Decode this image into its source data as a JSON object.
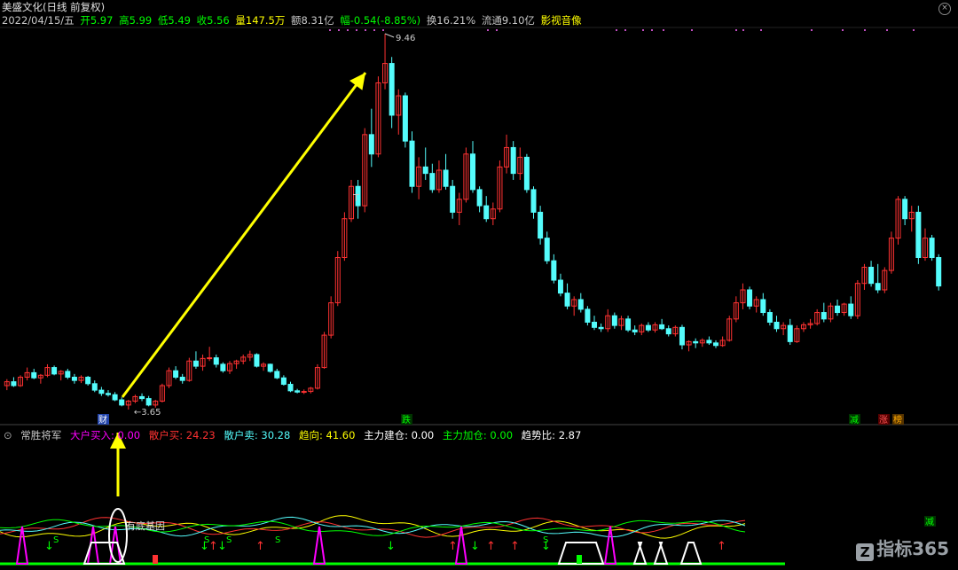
{
  "header": {
    "title": "美盛文化(日线 前复权)",
    "date": "2022/04/15/五",
    "open": "开5.97",
    "high": "高5.99",
    "low": "低5.49",
    "close": "收5.56",
    "volume": "量147.5万",
    "amount": "额8.31亿",
    "change": "幅-0.54(-8.85%)",
    "turnover": "换16.21%",
    "float": "流通9.10亿",
    "sector": "影视音像"
  },
  "indicator": {
    "name": "常胜将军",
    "big_buy": "大户买入: 0.00",
    "retail_sell": "散户买: 24.23",
    "retail_out": "散户卖: 30.28",
    "trend": "趋向: 41.60",
    "main_build": "主力建仓: 0.00",
    "main_add": "主力加仓: 0.00",
    "trend_ratio": "趋势比: 2.87",
    "note": "有底基因"
  },
  "watermark": "指标365",
  "colors": {
    "up": "#ff3232",
    "down": "#54fcfc",
    "arrow": "#ffff00",
    "magenta": "#ff00ff",
    "green": "#00ff00"
  },
  "chart_data": {
    "type": "candlestick",
    "y_labels": {
      "high_mark": "9.46",
      "low_mark": "3.65"
    },
    "tags": [
      "财",
      "跌",
      "减",
      "涨",
      "榜"
    ],
    "candles": [
      [
        4.02,
        4.12,
        3.95,
        4.08
      ],
      [
        4.08,
        4.15,
        4.0,
        4.02
      ],
      [
        4.02,
        4.18,
        4.0,
        4.15
      ],
      [
        4.15,
        4.3,
        4.1,
        4.22
      ],
      [
        4.22,
        4.28,
        4.12,
        4.14
      ],
      [
        4.14,
        4.2,
        4.05,
        4.18
      ],
      [
        4.18,
        4.35,
        4.15,
        4.3
      ],
      [
        4.3,
        4.33,
        4.18,
        4.2
      ],
      [
        4.2,
        4.26,
        4.1,
        4.24
      ],
      [
        4.24,
        4.28,
        4.12,
        4.15
      ],
      [
        4.15,
        4.2,
        4.05,
        4.1
      ],
      [
        4.1,
        4.18,
        4.06,
        4.15
      ],
      [
        4.15,
        4.17,
        4.02,
        4.05
      ],
      [
        4.05,
        4.1,
        3.92,
        3.95
      ],
      [
        3.95,
        4.0,
        3.86,
        3.9
      ],
      [
        3.9,
        3.95,
        3.85,
        3.88
      ],
      [
        3.88,
        3.92,
        3.78,
        3.8
      ],
      [
        3.8,
        3.84,
        3.7,
        3.72
      ],
      [
        3.72,
        3.8,
        3.65,
        3.78
      ],
      [
        3.78,
        3.88,
        3.75,
        3.85
      ],
      [
        3.85,
        3.9,
        3.78,
        3.82
      ],
      [
        3.82,
        3.86,
        3.7,
        3.72
      ],
      [
        3.72,
        3.8,
        3.68,
        3.78
      ],
      [
        3.78,
        4.05,
        3.76,
        4.02
      ],
      [
        4.02,
        4.3,
        3.98,
        4.25
      ],
      [
        4.25,
        4.32,
        4.12,
        4.15
      ],
      [
        4.15,
        4.2,
        4.05,
        4.1
      ],
      [
        4.1,
        4.45,
        4.08,
        4.4
      ],
      [
        4.4,
        4.55,
        4.28,
        4.32
      ],
      [
        4.32,
        4.5,
        4.25,
        4.44
      ],
      [
        4.44,
        4.62,
        4.4,
        4.45
      ],
      [
        4.45,
        4.5,
        4.3,
        4.35
      ],
      [
        4.35,
        4.38,
        4.22,
        4.25
      ],
      [
        4.25,
        4.4,
        4.2,
        4.36
      ],
      [
        4.36,
        4.42,
        4.28,
        4.4
      ],
      [
        4.4,
        4.5,
        4.35,
        4.46
      ],
      [
        4.46,
        4.56,
        4.4,
        4.5
      ],
      [
        4.5,
        4.52,
        4.3,
        4.32
      ],
      [
        4.32,
        4.38,
        4.25,
        4.35
      ],
      [
        4.35,
        4.36,
        4.22,
        4.24
      ],
      [
        4.24,
        4.28,
        4.12,
        4.14
      ],
      [
        4.14,
        4.18,
        4.02,
        4.04
      ],
      [
        4.04,
        4.08,
        3.92,
        3.94
      ],
      [
        3.94,
        3.97,
        3.9,
        3.92
      ],
      [
        3.92,
        3.96,
        3.89,
        3.93
      ],
      [
        3.93,
        4.0,
        3.9,
        3.98
      ],
      [
        3.98,
        4.35,
        3.96,
        4.3
      ],
      [
        4.3,
        4.85,
        4.28,
        4.8
      ],
      [
        4.8,
        5.4,
        4.75,
        5.3
      ],
      [
        5.3,
        6.1,
        5.25,
        6.0
      ],
      [
        6.0,
        6.7,
        5.95,
        6.6
      ],
      [
        6.6,
        7.2,
        6.55,
        7.1
      ],
      [
        7.1,
        7.2,
        6.6,
        6.8
      ],
      [
        6.8,
        8.0,
        6.7,
        7.9
      ],
      [
        7.9,
        8.3,
        7.4,
        7.6
      ],
      [
        7.6,
        8.8,
        7.55,
        8.7
      ],
      [
        8.7,
        9.46,
        8.6,
        9.0
      ],
      [
        9.0,
        9.1,
        8.0,
        8.2
      ],
      [
        8.2,
        8.6,
        7.9,
        8.5
      ],
      [
        8.5,
        8.55,
        7.7,
        7.8
      ],
      [
        7.8,
        7.95,
        7.0,
        7.1
      ],
      [
        7.1,
        7.55,
        6.9,
        7.4
      ],
      [
        7.4,
        7.7,
        7.2,
        7.3
      ],
      [
        7.3,
        7.45,
        7.0,
        7.05
      ],
      [
        7.05,
        7.5,
        7.0,
        7.35
      ],
      [
        7.35,
        7.6,
        7.05,
        7.1
      ],
      [
        7.1,
        7.2,
        6.6,
        6.7
      ],
      [
        6.7,
        7.0,
        6.5,
        6.9
      ],
      [
        6.9,
        7.7,
        6.85,
        7.6
      ],
      [
        7.6,
        7.8,
        7.0,
        7.05
      ],
      [
        7.05,
        7.1,
        6.7,
        6.8
      ],
      [
        6.8,
        6.95,
        6.55,
        6.6
      ],
      [
        6.6,
        6.85,
        6.5,
        6.75
      ],
      [
        6.75,
        7.5,
        6.7,
        7.4
      ],
      [
        7.4,
        7.9,
        7.3,
        7.7
      ],
      [
        7.7,
        7.8,
        7.2,
        7.3
      ],
      [
        7.3,
        7.7,
        7.2,
        7.55
      ],
      [
        7.55,
        7.6,
        7.0,
        7.05
      ],
      [
        7.05,
        7.1,
        6.6,
        6.7
      ],
      [
        6.7,
        6.8,
        6.2,
        6.3
      ],
      [
        6.3,
        6.4,
        5.9,
        5.95
      ],
      [
        5.95,
        6.05,
        5.6,
        5.65
      ],
      [
        5.65,
        5.75,
        5.4,
        5.45
      ],
      [
        5.45,
        5.6,
        5.2,
        5.25
      ],
      [
        5.25,
        5.4,
        5.1,
        5.35
      ],
      [
        5.35,
        5.45,
        5.15,
        5.2
      ],
      [
        5.2,
        5.25,
        4.95,
        5.0
      ],
      [
        5.0,
        5.1,
        4.88,
        4.92
      ],
      [
        4.92,
        4.98,
        4.85,
        4.9
      ],
      [
        4.9,
        5.2,
        4.85,
        5.1
      ],
      [
        5.1,
        5.15,
        4.9,
        4.95
      ],
      [
        4.95,
        5.1,
        4.88,
        5.05
      ],
      [
        5.05,
        5.1,
        4.85,
        4.88
      ],
      [
        4.88,
        4.95,
        4.8,
        4.85
      ],
      [
        4.85,
        4.98,
        4.8,
        4.95
      ],
      [
        4.95,
        5.0,
        4.85,
        4.88
      ],
      [
        4.88,
        5.0,
        4.84,
        4.96
      ],
      [
        4.96,
        5.05,
        4.88,
        4.9
      ],
      [
        4.9,
        4.95,
        4.78,
        4.82
      ],
      [
        4.82,
        4.95,
        4.78,
        4.92
      ],
      [
        4.92,
        4.96,
        4.58,
        4.65
      ],
      [
        4.65,
        4.72,
        4.55,
        4.7
      ],
      [
        4.7,
        4.75,
        4.6,
        4.68
      ],
      [
        4.68,
        4.75,
        4.62,
        4.72
      ],
      [
        4.72,
        4.78,
        4.65,
        4.68
      ],
      [
        4.68,
        4.72,
        4.6,
        4.64
      ],
      [
        4.64,
        4.78,
        4.62,
        4.72
      ],
      [
        4.72,
        5.1,
        4.7,
        5.05
      ],
      [
        5.05,
        5.4,
        5.0,
        5.3
      ],
      [
        5.3,
        5.6,
        5.2,
        5.5
      ],
      [
        5.5,
        5.55,
        5.2,
        5.25
      ],
      [
        5.25,
        5.4,
        5.15,
        5.35
      ],
      [
        5.35,
        5.45,
        5.1,
        5.15
      ],
      [
        5.15,
        5.2,
        4.95,
        5.0
      ],
      [
        5.0,
        5.1,
        4.85,
        4.9
      ],
      [
        4.9,
        5.0,
        4.8,
        4.95
      ],
      [
        4.95,
        5.05,
        4.65,
        4.7
      ],
      [
        4.7,
        4.95,
        4.68,
        4.9
      ],
      [
        4.9,
        5.0,
        4.85,
        4.96
      ],
      [
        4.96,
        5.05,
        4.9,
        4.98
      ],
      [
        4.98,
        5.2,
        4.95,
        5.15
      ],
      [
        5.15,
        5.3,
        5.0,
        5.05
      ],
      [
        5.05,
        5.3,
        5.0,
        5.25
      ],
      [
        5.25,
        5.35,
        5.1,
        5.15
      ],
      [
        5.15,
        5.3,
        5.1,
        5.28
      ],
      [
        5.28,
        5.4,
        5.05,
        5.1
      ],
      [
        5.1,
        5.65,
        5.05,
        5.6
      ],
      [
        5.6,
        5.9,
        5.5,
        5.85
      ],
      [
        5.85,
        5.95,
        5.55,
        5.6
      ],
      [
        5.6,
        5.9,
        5.45,
        5.5
      ],
      [
        5.5,
        5.85,
        5.45,
        5.8
      ],
      [
        5.8,
        6.4,
        5.75,
        6.3
      ],
      [
        6.3,
        6.95,
        6.2,
        6.9
      ],
      [
        6.9,
        6.95,
        6.5,
        6.6
      ],
      [
        6.6,
        6.8,
        6.4,
        6.7
      ],
      [
        6.7,
        6.8,
        5.9,
        6.0
      ],
      [
        6.0,
        6.45,
        5.95,
        6.3
      ],
      [
        6.3,
        6.35,
        5.95,
        6.0
      ],
      [
        6.0,
        6.05,
        5.49,
        5.56
      ]
    ]
  }
}
